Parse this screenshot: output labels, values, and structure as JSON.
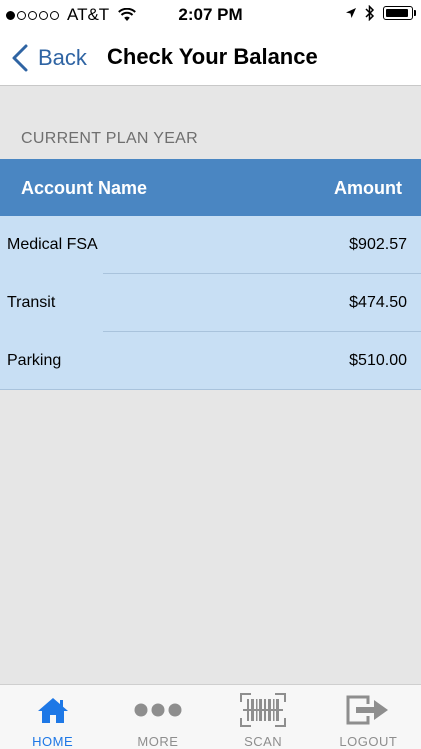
{
  "status_bar": {
    "carrier": "AT&T",
    "time": "2:07 PM"
  },
  "nav": {
    "back_label": "Back",
    "title": "Check Your Balance"
  },
  "section": {
    "header": "CURRENT PLAN YEAR"
  },
  "table": {
    "columns": [
      "Account Name",
      "Amount"
    ],
    "rows": [
      {
        "name": "Medical FSA",
        "amount": "$902.57"
      },
      {
        "name": "Transit",
        "amount": "$474.50"
      },
      {
        "name": "Parking",
        "amount": "$510.00"
      }
    ]
  },
  "tabs": [
    {
      "label": "HOME",
      "icon": "home-icon",
      "active": true
    },
    {
      "label": "MORE",
      "icon": "more-icon",
      "active": false
    },
    {
      "label": "SCAN",
      "icon": "barcode-scan-icon",
      "active": false
    },
    {
      "label": "LOGOUT",
      "icon": "logout-icon",
      "active": false
    }
  ],
  "colors": {
    "accent": "#1e78e6",
    "header_blue": "#4a86c2",
    "row_blue": "#c8dff4"
  }
}
